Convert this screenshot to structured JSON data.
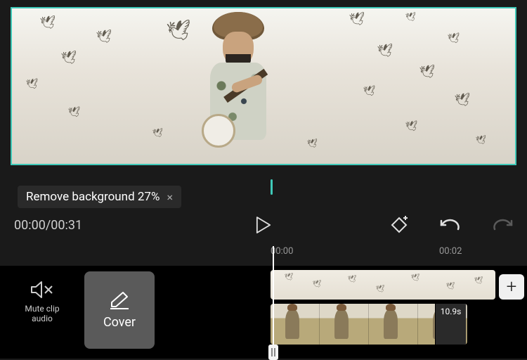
{
  "progress": {
    "label": "Remove background 27%",
    "close_icon": "×"
  },
  "playback": {
    "current_time": "00:00",
    "total_time": "00:31",
    "combined": "00:00/00:31"
  },
  "ruler": {
    "tick1": "00:00",
    "tick2": "00:02"
  },
  "actions": {
    "mute": {
      "line1": "Mute clip",
      "line2": "audio"
    },
    "cover_label": "Cover"
  },
  "clip": {
    "duration": "10.9s"
  },
  "icons": {
    "add": "+",
    "play": "play-icon",
    "keyframe": "keyframe-icon",
    "undo": "undo-icon",
    "redo": "redo-icon",
    "mute": "speaker-mute-icon",
    "edit": "pencil-edit-icon"
  },
  "colors": {
    "accent": "#3fc9b8",
    "bg_dark": "#1a1a1a",
    "bg_black": "#000000"
  }
}
